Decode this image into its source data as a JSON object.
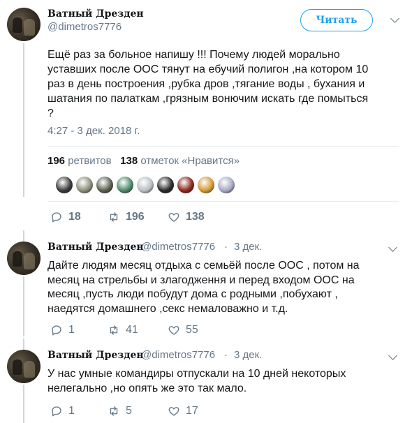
{
  "colors": {
    "accent": "#1da1f2",
    "muted": "#657786",
    "text": "#14171a",
    "divider": "#e6ecf0"
  },
  "main_tweet": {
    "author_name": "Ватный Дрезден",
    "author_handle": "@dimetros7776",
    "follow_label": "Читать",
    "text": "Ещё раз за больное напишу !!! Почему людей морально\nуставших после ООС тянут на ебучий полигон ,на котором 10\nраз в день построения ,рубка дров ,тягание воды , бухания и\nшатания по палаткам ,грязным вонючим искать где помыться\n?",
    "timestamp": "4:27 - 3 дек. 2018 г.",
    "retweets_count": "196",
    "retweets_label": "ретвитов",
    "likes_count": "138",
    "likes_label": "отметок «Нравится»",
    "likers": [
      "#3b3b3b",
      "#8a8f7a",
      "#5a6150",
      "#4d8a6a",
      "#b9bfc2",
      "#2a2a2a",
      "#8c2a1c",
      "#d29a36",
      "#a7a9c4"
    ],
    "actions": {
      "replies": "18",
      "retweets": "196",
      "likes": "138"
    }
  },
  "replies": [
    {
      "author_name": "Ватный Дрезден",
      "author_handle": "@dimetros7776",
      "separator": "·",
      "date": "3 дек.",
      "text": "Дайте людям месяц отдыха с семьёй после ООС , потом на\nмесяц на стрельбы и злагодження и перед входом ООС на\nмесяц ,пусть люди  побудут дома с родными ,побухают ,\nнаедятся домашнего ,секс немаловажно и т.д.",
      "actions": {
        "replies": "1",
        "retweets": "41",
        "likes": "55"
      }
    },
    {
      "author_name": "Ватный Дрезден",
      "author_handle": "@dimetros7776",
      "separator": "·",
      "date": "3 дек.",
      "text": "У нас умные командиры отпускали на 10 дней некоторых\nнелегально ,но опять же это так мало.",
      "actions": {
        "replies": "1",
        "retweets": "5",
        "likes": "17"
      }
    }
  ]
}
